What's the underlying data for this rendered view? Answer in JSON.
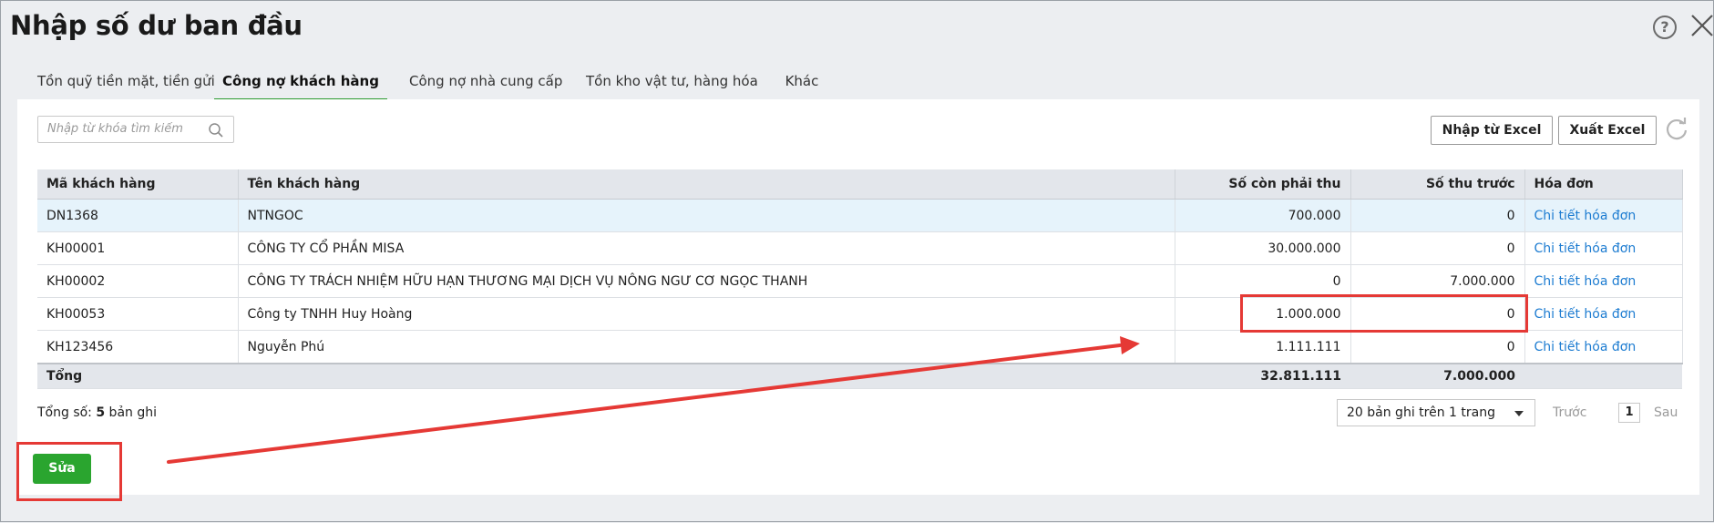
{
  "dialog": {
    "title": "Nhập số dư ban đầu"
  },
  "tabs": [
    {
      "label": "Tồn quỹ tiền mặt, tiền gửi",
      "active": false
    },
    {
      "label": "Công nợ khách hàng",
      "active": true
    },
    {
      "label": "Công nợ nhà cung cấp",
      "active": false
    },
    {
      "label": "Tồn kho vật tư, hàng hóa",
      "active": false
    },
    {
      "label": "Khác",
      "active": false
    }
  ],
  "search": {
    "placeholder": "Nhập từ khóa tìm kiếm",
    "value": ""
  },
  "toolbar": {
    "import_label": "Nhập từ Excel",
    "export_label": "Xuất Excel"
  },
  "table": {
    "headers": [
      "Mã khách hàng",
      "Tên khách hàng",
      "Số còn phải thu",
      "Số thu trước",
      "Hóa đơn"
    ],
    "rows": [
      [
        "DN1368",
        "NTNGOC",
        "700.000",
        "0",
        "Chi tiết hóa đơn"
      ],
      [
        "KH00001",
        "CÔNG TY CỔ PHẦN MISA",
        "30.000.000",
        "0",
        "Chi tiết hóa đơn"
      ],
      [
        "KH00002",
        "CÔNG TY TRÁCH NHIỆM HỮU HẠN THƯƠNG MẠI DỊCH VỤ NÔNG NGƯ CƠ NGỌC THANH",
        "0",
        "7.000.000",
        "Chi tiết hóa đơn"
      ],
      [
        "KH00053",
        "Công ty TNHH Huy Hoàng",
        "1.000.000",
        "0",
        "Chi tiết hóa đơn"
      ],
      [
        "KH123456",
        "Nguyễn Phú",
        "1.111.111",
        "0",
        "Chi tiết hóa đơn"
      ]
    ],
    "total": {
      "label": "Tổng",
      "receivable": "32.811.111",
      "prepaid": "7.000.000"
    }
  },
  "footer": {
    "count_prefix": "Tổng số: ",
    "count_value": "5",
    "count_suffix": " bản ghi",
    "page_size": "20 bản ghi trên 1 trang",
    "prev": "Trước",
    "page": "1",
    "next": "Sau"
  },
  "actions": {
    "save_label": "Sửa"
  },
  "colors": {
    "accent": "#2aa52f",
    "link": "#1d7cd1",
    "highlight": "#e53935"
  }
}
